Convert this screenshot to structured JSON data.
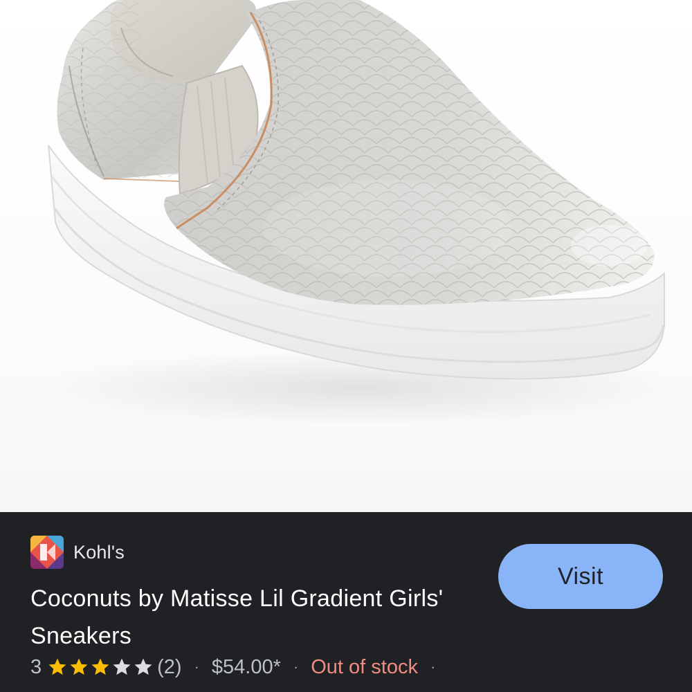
{
  "merchant": {
    "name": "Kohl's",
    "logo_icon": "kohls-logo-icon",
    "logo_colors": [
      "#e9544a",
      "#f4b63f",
      "#8a2c6b",
      "#4aa5d9",
      "#5b3a8c"
    ]
  },
  "product": {
    "title": "Coconuts by Matisse Lil Gradient Girls' Sneakers",
    "image_icon": "silver-slip-on-sneaker-image"
  },
  "rating": {
    "value": "3",
    "stars_filled": 3,
    "stars_total": 5,
    "review_count": "(2)"
  },
  "separators": {
    "dot": "·"
  },
  "price": "$54.00*",
  "availability": "Out of stock",
  "visit_button": {
    "label": "Visit"
  },
  "colors": {
    "panel_background": "#202124",
    "button_background": "#8ab4f8",
    "star_filled": "#fbbc04",
    "star_empty": "#dadce0",
    "out_of_stock": "#f28b82"
  }
}
